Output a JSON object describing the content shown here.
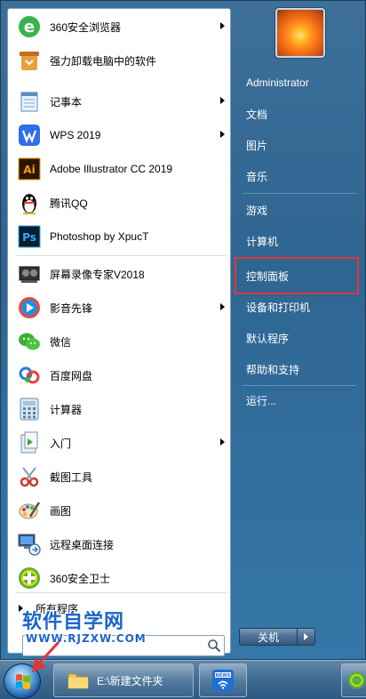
{
  "programs": [
    {
      "label": "360安全浏览器",
      "icon": "ie-browser-icon",
      "submenu": true
    },
    {
      "label": "强力卸载电脑中的软件",
      "icon": "uninstaller-icon",
      "submenu": false
    },
    {
      "label": "记事本",
      "icon": "notepad-icon",
      "submenu": true
    },
    {
      "label": "WPS 2019",
      "icon": "wps-icon",
      "submenu": true
    },
    {
      "label": "Adobe Illustrator CC 2019",
      "icon": "illustrator-icon",
      "submenu": false
    },
    {
      "label": "腾讯QQ",
      "icon": "qq-penguin-icon",
      "submenu": false
    },
    {
      "label": "Photoshop by XpucT",
      "icon": "photoshop-icon",
      "submenu": false
    },
    {
      "label": "屏幕录像专家V2018",
      "icon": "screen-recorder-icon",
      "submenu": false
    },
    {
      "label": "影音先锋",
      "icon": "media-player-icon",
      "submenu": true
    },
    {
      "label": "微信",
      "icon": "wechat-icon",
      "submenu": false
    },
    {
      "label": "百度网盘",
      "icon": "baidu-netdisk-icon",
      "submenu": false
    },
    {
      "label": "计算器",
      "icon": "calculator-icon",
      "submenu": false
    },
    {
      "label": "入门",
      "icon": "getting-started-icon",
      "submenu": true
    },
    {
      "label": "截图工具",
      "icon": "snipping-tool-icon",
      "submenu": false
    },
    {
      "label": "画图",
      "icon": "paint-icon",
      "submenu": false
    },
    {
      "label": "远程桌面连接",
      "icon": "remote-desktop-icon",
      "submenu": false
    },
    {
      "label": "360安全卫士",
      "icon": "360-safeguard-icon",
      "submenu": false
    }
  ],
  "all_programs_label": "所有程序",
  "search": {
    "value": "",
    "placeholder": ""
  },
  "watermark": {
    "title": "软件自学网",
    "url": "WWW.RJZXW.COM"
  },
  "right_panel": {
    "username": "Administrator",
    "items": [
      "文档",
      "图片",
      "音乐",
      "游戏",
      "计算机",
      "控制面板",
      "设备和打印机",
      "默认程序",
      "帮助和支持",
      "运行..."
    ]
  },
  "shutdown_label": "关机",
  "taskbar": {
    "folder_label": "E:\\新建文件夹",
    "news_badge": "NEWS"
  },
  "colors": {
    "highlight": "#e0353a",
    "watermark": "#1b66c9"
  }
}
